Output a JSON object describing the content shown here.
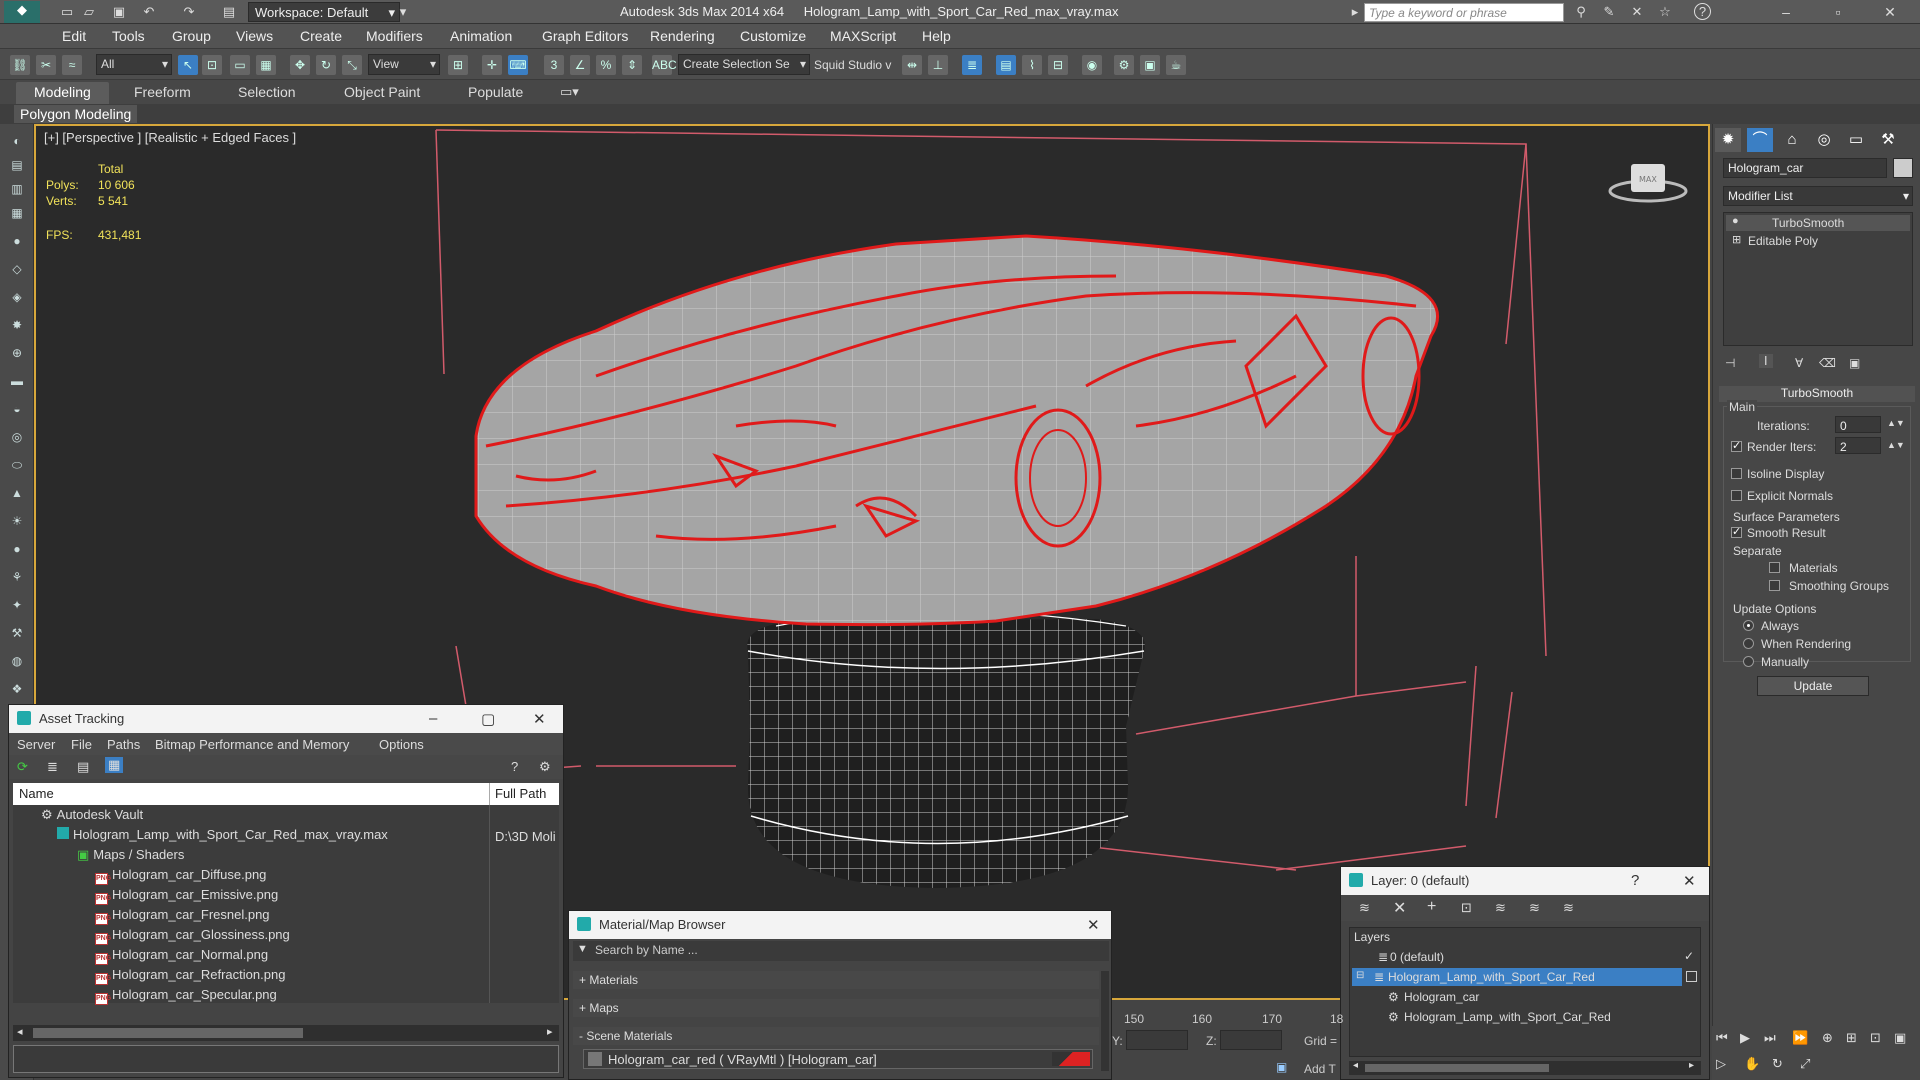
{
  "window": {
    "app_name": "Autodesk 3ds Max  2014 x64",
    "file_name": "Hologram_Lamp_with_Sport_Car_Red_max_vray.max",
    "workspace_label": "Workspace: Default",
    "search_placeholder": "Type a keyword or phrase"
  },
  "menu": [
    "Edit",
    "Tools",
    "Group",
    "Views",
    "Create",
    "Modifiers",
    "Animation",
    "Graph Editors",
    "Rendering",
    "Customize",
    "MAXScript",
    "Help"
  ],
  "toolbar": {
    "filter_value": "All",
    "refcoord_value": "View",
    "selection_set_placeholder": "Create Selection Se",
    "squid_label": "Squid Studio v"
  },
  "ribbon": {
    "tabs": [
      "Modeling",
      "Freeform",
      "Selection",
      "Object Paint",
      "Populate"
    ],
    "active_tab": "Modeling",
    "sub_label": "Polygon Modeling"
  },
  "viewport": {
    "label": "[+] [Perspective ] [Realistic + Edged Faces ]",
    "stats": {
      "total_label": "Total",
      "polys_label": "Polys:",
      "polys_value": "10 606",
      "verts_label": "Verts:",
      "verts_value": "5 541",
      "fps_label": "FPS:",
      "fps_value": "431,481"
    },
    "colors": {
      "wire_red": "#e01a1a",
      "shell_gray": "#a5a5a5",
      "bbox": "#d25b6b"
    }
  },
  "command_panel": {
    "object_name": "Hologram_car",
    "modifier_list": "Modifier List",
    "stack": [
      "TurboSmooth",
      "Editable Poly"
    ],
    "rollout_title": "TurboSmooth",
    "main_label": "Main",
    "iterations_label": "Iterations:",
    "iterations_value": "0",
    "render_iters_label": "Render Iters:",
    "render_iters_value": "2",
    "isoline_label": "Isoline Display",
    "explicit_label": "Explicit Normals",
    "surface_label": "Surface Parameters",
    "smooth_result_label": "Smooth Result",
    "separate_label": "Separate",
    "materials_label": "Materials",
    "smoothing_groups_label": "Smoothing Groups",
    "update_options_label": "Update Options",
    "always_label": "Always",
    "when_rendering_label": "When Rendering",
    "manually_label": "Manually",
    "update_button": "Update"
  },
  "asset_tracking": {
    "title": "Asset Tracking",
    "menu": [
      "Server",
      "File",
      "Paths",
      "Bitmap Performance and Memory",
      "Options"
    ],
    "col_name": "Name",
    "col_path": "Full Path",
    "vault": "Autodesk Vault",
    "max_file": "Hologram_Lamp_with_Sport_Car_Red_max_vray.max",
    "max_path": "D:\\3D Moli",
    "maps_folder": "Maps / Shaders",
    "maps": [
      "Hologram_car_Diffuse.png",
      "Hologram_car_Emissive.png",
      "Hologram_car_Fresnel.png",
      "Hologram_car_Glossiness.png",
      "Hologram_car_Normal.png",
      "Hologram_car_Refraction.png",
      "Hologram_car_Specular.png"
    ],
    "png_tag": "PNG"
  },
  "material_browser": {
    "title": "Material/Map Browser",
    "search_placeholder": "Search by Name ...",
    "groups": [
      "+ Materials",
      "+ Maps",
      "- Scene Materials"
    ],
    "scene_material": "Hologram_car_red  ( VRayMtl ) [Hologram_car]"
  },
  "layers": {
    "title": "Layer: 0 (default)",
    "header": "Layers",
    "rows": [
      "0 (default)",
      "Hologram_Lamp_with_Sport_Car_Red",
      "Hologram_car",
      "Hologram_Lamp_with_Sport_Car_Red"
    ]
  },
  "timeline": {
    "ticks": [
      "150",
      "160",
      "170",
      "18"
    ],
    "y_label": "Y:",
    "z_label": "Z:",
    "grid_label": "Grid =",
    "add_t_label": "Add T"
  }
}
